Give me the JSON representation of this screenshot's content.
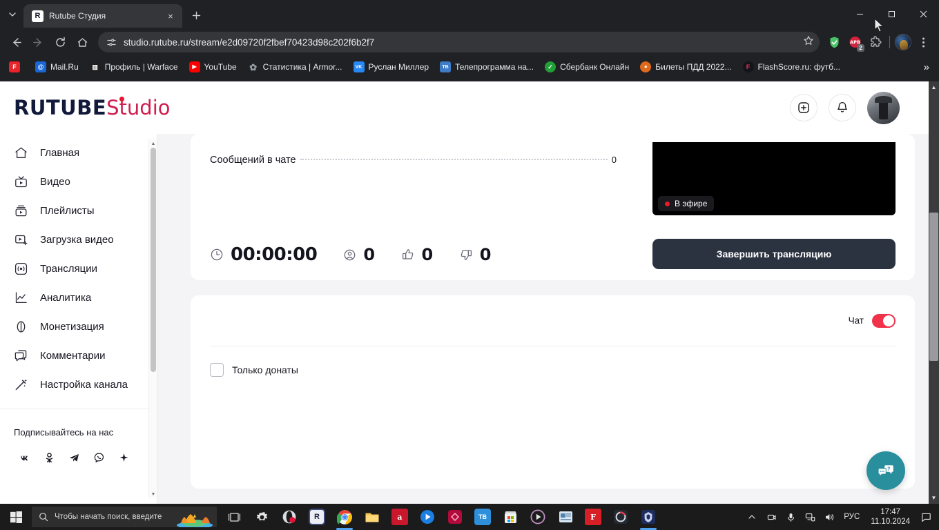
{
  "browser": {
    "tab": {
      "title": "Rutube Студия",
      "favicon_letter": "R"
    },
    "new_tab_label": "+",
    "tab_search_icon": "chevron-down-icon",
    "close_icon": "×",
    "nav": {
      "back_icon": "arrow-left-icon",
      "forward_icon": "arrow-right-icon",
      "reload_icon": "reload-icon",
      "home_icon": "home-icon"
    },
    "omnibox": {
      "url": "studio.rutube.ru/stream/e2d09720f2fbef70423d98c202f6b2f7",
      "site_info_icon": "page-settings-icon",
      "bookmark_icon": "star-icon"
    },
    "extensions": [
      {
        "name": "shield-extension",
        "badge": ""
      },
      {
        "name": "adblock-extension",
        "label": "APB",
        "badge": "2"
      },
      {
        "name": "extensions-puzzle-icon",
        "badge": ""
      }
    ],
    "menu_icon": "three-dots-icon",
    "window_controls": {
      "minimize": "—",
      "maximize": "▢",
      "close": "✕"
    },
    "bookmarks": [
      {
        "label": "",
        "icon_letter": "F",
        "color": "#e8232a"
      },
      {
        "label": "Mail.Ru",
        "icon_letter": "@",
        "color": "#1a66d6"
      },
      {
        "label": "Профиль | Warface",
        "icon_letter": "▥",
        "color": "#2b2b2b"
      },
      {
        "label": "YouTube",
        "icon_letter": "▶",
        "color": "#ff0000"
      },
      {
        "label": "Статистика | Armor...",
        "icon_letter": "✿",
        "color": "#6d6d6d"
      },
      {
        "label": "Руслан Миллер",
        "icon_letter": "VK",
        "color": "#2787f5"
      },
      {
        "label": "Телепрограмма на...",
        "icon_letter": "TB",
        "color": "#3f7cc8"
      },
      {
        "label": "Сбербанк Онлайн",
        "icon_letter": "✓",
        "color": "#21a038"
      },
      {
        "label": "Билеты ПДД 2022...",
        "icon_letter": "●",
        "color": "#e06a1b"
      },
      {
        "label": "FlashScore.ru: футб...",
        "icon_letter": "F",
        "color": "#1b1b22"
      }
    ],
    "bookmarks_overflow_icon": "»"
  },
  "app": {
    "logo": {
      "primary": "RUTUBE",
      "secondary": "Studio"
    },
    "header": {
      "add_button_icon": "plus-square-icon",
      "notifications_icon": "bell-icon",
      "avatar_name": "user-avatar"
    },
    "sidebar": {
      "items": [
        {
          "label": "Главная",
          "icon": "home-icon"
        },
        {
          "label": "Видео",
          "icon": "tv-icon"
        },
        {
          "label": "Плейлисты",
          "icon": "playlist-icon"
        },
        {
          "label": "Загрузка видео",
          "icon": "upload-video-icon"
        },
        {
          "label": "Трансляции",
          "icon": "broadcast-icon"
        },
        {
          "label": "Аналитика",
          "icon": "analytics-icon"
        },
        {
          "label": "Монетизация",
          "icon": "coin-icon"
        },
        {
          "label": "Комментарии",
          "icon": "comments-icon"
        },
        {
          "label": "Настройка канала",
          "icon": "magic-wand-icon"
        }
      ],
      "follow_title": "Подписывайтесь на нас",
      "socials": [
        {
          "name": "vk-icon",
          "glyph": "VK"
        },
        {
          "name": "odnoklassniki-icon",
          "glyph": "OK"
        },
        {
          "name": "telegram-icon",
          "glyph": "➤"
        },
        {
          "name": "viber-icon",
          "glyph": "✆"
        },
        {
          "name": "sparkle-icon",
          "glyph": "✦"
        }
      ]
    },
    "stream": {
      "chat_messages_label": "Сообщений в чате",
      "chat_messages_value": "0",
      "duration_label": "00:00:00",
      "duration_icon": "clock-icon",
      "viewers_value": "0",
      "viewers_icon": "viewer-icon",
      "likes_value": "0",
      "likes_icon": "thumb-up-icon",
      "dislikes_value": "0",
      "dislikes_icon": "thumb-down-icon",
      "live_badge": "В эфире",
      "end_stream_button": "Завершить трансляцию"
    },
    "chat_panel": {
      "toggle_label": "Чат",
      "toggle_on": true,
      "donates_only_label": "Только донаты",
      "donates_only_checked": false
    },
    "support_fab_icon": "support-chat-icon",
    "colors": {
      "brand_dark": "#111a3a",
      "brand_accent": "#cf1e4e",
      "toggle_on": "#f0324a",
      "end_button": "#2c3340",
      "fab": "#2a8f9c",
      "live_dot": "#ec1a2e"
    }
  },
  "taskbar": {
    "start_icon": "windows-start-icon",
    "search_placeholder": "Чтобы начать поиск, введите",
    "search_icon": "search-icon",
    "apps": [
      {
        "name": "task-view",
        "glyph": "❑",
        "color": "transparent",
        "active": false
      },
      {
        "name": "settings-app",
        "glyph": "⚙",
        "color": "transparent",
        "active": false
      },
      {
        "name": "opera-gx-app",
        "glyph": "O",
        "color": "#2b2b34",
        "active": false
      },
      {
        "name": "rutube-app",
        "glyph": "R",
        "color": "#2b2f45",
        "active": false
      },
      {
        "name": "chrome-app",
        "glyph": "◍",
        "color": "transparent",
        "active": true
      },
      {
        "name": "file-explorer-app",
        "glyph": "📁",
        "color": "transparent",
        "active": false
      },
      {
        "name": "adobe-app",
        "glyph": "a",
        "color": "#c9182b",
        "active": false
      },
      {
        "name": "media-player-app",
        "glyph": "▶",
        "color": "#1a7fe0",
        "active": false
      },
      {
        "name": "lens-app",
        "glyph": "◇",
        "color": "#c4103d",
        "active": false
      },
      {
        "name": "tb-app",
        "glyph": "TB",
        "color": "#2e8fdb",
        "active": false
      },
      {
        "name": "microsoft-store-app",
        "glyph": "▤",
        "color": "#efefef",
        "active": false
      },
      {
        "name": "player-app",
        "glyph": "▶",
        "color": "#8a6a9c",
        "active": false
      },
      {
        "name": "news-app",
        "glyph": "▤",
        "color": "#4f82ad",
        "active": false
      },
      {
        "name": "flash-app",
        "glyph": "F",
        "color": "#d61f26",
        "active": false
      },
      {
        "name": "game-launcher-app",
        "glyph": "G",
        "color": "#2a2f36",
        "active": false
      },
      {
        "name": "warface-app",
        "glyph": "W",
        "color": "#1d2d5e",
        "active": true
      }
    ],
    "tray": {
      "overflow_icon": "chevron-up-icon",
      "camera_icon": "camera-icon",
      "mic_icon": "microphone-icon",
      "network_icon": "network-icon",
      "volume_icon": "volume-icon",
      "language": "РУС",
      "time": "17:47",
      "date": "11.10.2024",
      "notifications_icon": "notification-center-icon"
    }
  }
}
